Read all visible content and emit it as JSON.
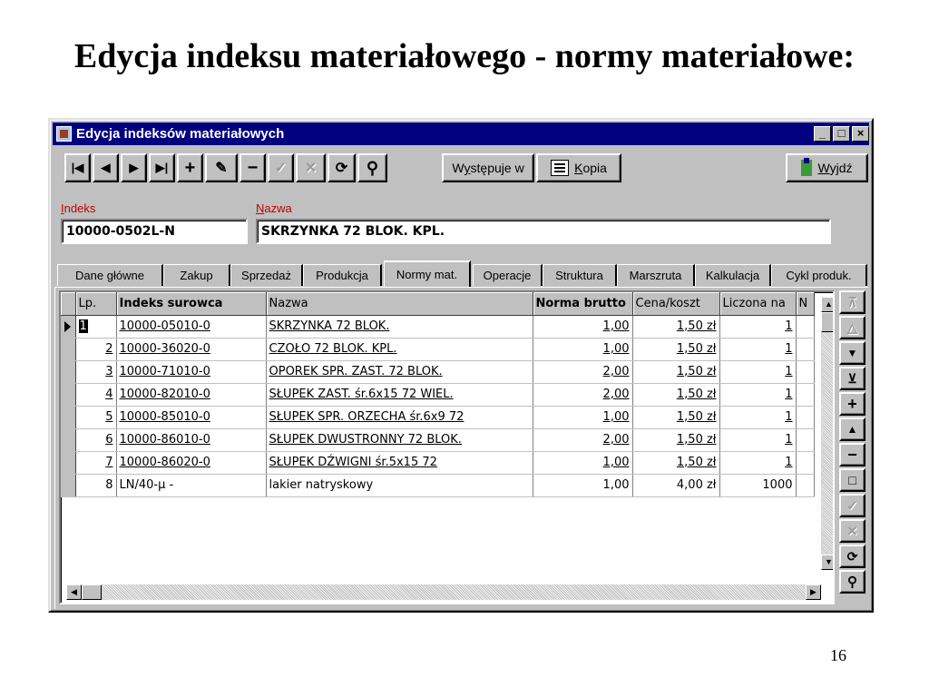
{
  "slide": {
    "title": "Edycja indeksu materiałowego - normy materiałowe:",
    "page_number": "16"
  },
  "window": {
    "title": "Edycja indeksów materiałowych",
    "controls": {
      "minimize": "_",
      "maximize": "□",
      "close": "×"
    }
  },
  "toolbar": {
    "first": "|◀",
    "prev": "◀",
    "next": "▶",
    "last": "▶|",
    "add": "+",
    "edit": "✎",
    "delete": "−",
    "confirm": "✓",
    "cancel": "✕",
    "refresh": "⟳",
    "search": "⚲",
    "wystepuje_pre": "W",
    "wystepuje_hot": "y",
    "wystepuje_post": "stępuje w",
    "kopia_hot": "K",
    "kopia_post": "opia",
    "wyjdz_hot": "W",
    "wyjdz_post": "yjdź"
  },
  "fields": {
    "indeks_hot": "I",
    "indeks_rest": "ndeks",
    "indeks_value": "10000-0502L-N",
    "nazwa_hot": "N",
    "nazwa_rest": "azwa",
    "nazwa_value": "SKRZYNKA 72 BLOK. KPL."
  },
  "tabs": [
    "Dane główne",
    "Zakup",
    "Sprzedaż",
    "Produkcja",
    "Normy mat.",
    "Operacje",
    "Struktura",
    "Marszruta",
    "Kalkulacja",
    "Cykl produk."
  ],
  "active_tab": "Normy mat.",
  "table": {
    "headers": [
      "Lp.",
      "Indeks surowca",
      "Nazwa",
      "Norma brutto",
      "Cena/koszt",
      "Liczona na",
      "N"
    ],
    "rows": [
      {
        "lp": "1",
        "indeks": "10000-05010-0",
        "nazwa": "SKRZYNKA 72 BLOK.",
        "norma": "1,00",
        "cena": "1,50 zł",
        "liczona": "1"
      },
      {
        "lp": "2",
        "indeks": "10000-36020-0",
        "nazwa": "CZOŁO 72 BLOK. KPL.",
        "norma": "1,00",
        "cena": "1,50 zł",
        "liczona": "1"
      },
      {
        "lp": "3",
        "indeks": "10000-71010-0",
        "nazwa": "OPOREK SPR. ZAST. 72 BLOK.",
        "norma": "2,00",
        "cena": "1,50 zł",
        "liczona": "1"
      },
      {
        "lp": "4",
        "indeks": "10000-82010-0",
        "nazwa": "SŁUPEK ZAST. śr.6x15  72 WIEL.",
        "norma": "2,00",
        "cena": "1,50 zł",
        "liczona": "1"
      },
      {
        "lp": "5",
        "indeks": "10000-85010-0",
        "nazwa": "SŁUPEK SPR. ORZECHA śr.6x9  72",
        "norma": "1,00",
        "cena": "1,50 zł",
        "liczona": "1"
      },
      {
        "lp": "6",
        "indeks": "10000-86010-0",
        "nazwa": "SŁUPEK DWUSTRONNY 72 BLOK.",
        "norma": "2,00",
        "cena": "1,50 zł",
        "liczona": "1"
      },
      {
        "lp": "7",
        "indeks": "10000-86020-0",
        "nazwa": "SŁUPEK DŹWIGNI śr.5x15  72",
        "norma": "1,00",
        "cena": "1,50 zł",
        "liczona": "1"
      },
      {
        "lp": "8",
        "indeks": "LN/40-µ   -",
        "nazwa": "lakier natryskowy",
        "norma": "1,00",
        "cena": "4,00 zł",
        "liczona": "1000"
      }
    ]
  },
  "side_buttons": [
    "⊼",
    "△",
    "▼",
    "⊻",
    "+",
    "▲",
    "−",
    "□",
    "✓",
    "✕",
    "⟳",
    "⚲"
  ],
  "scroll": {
    "up": "▲",
    "down": "▼",
    "left": "◀",
    "right": "▶"
  }
}
